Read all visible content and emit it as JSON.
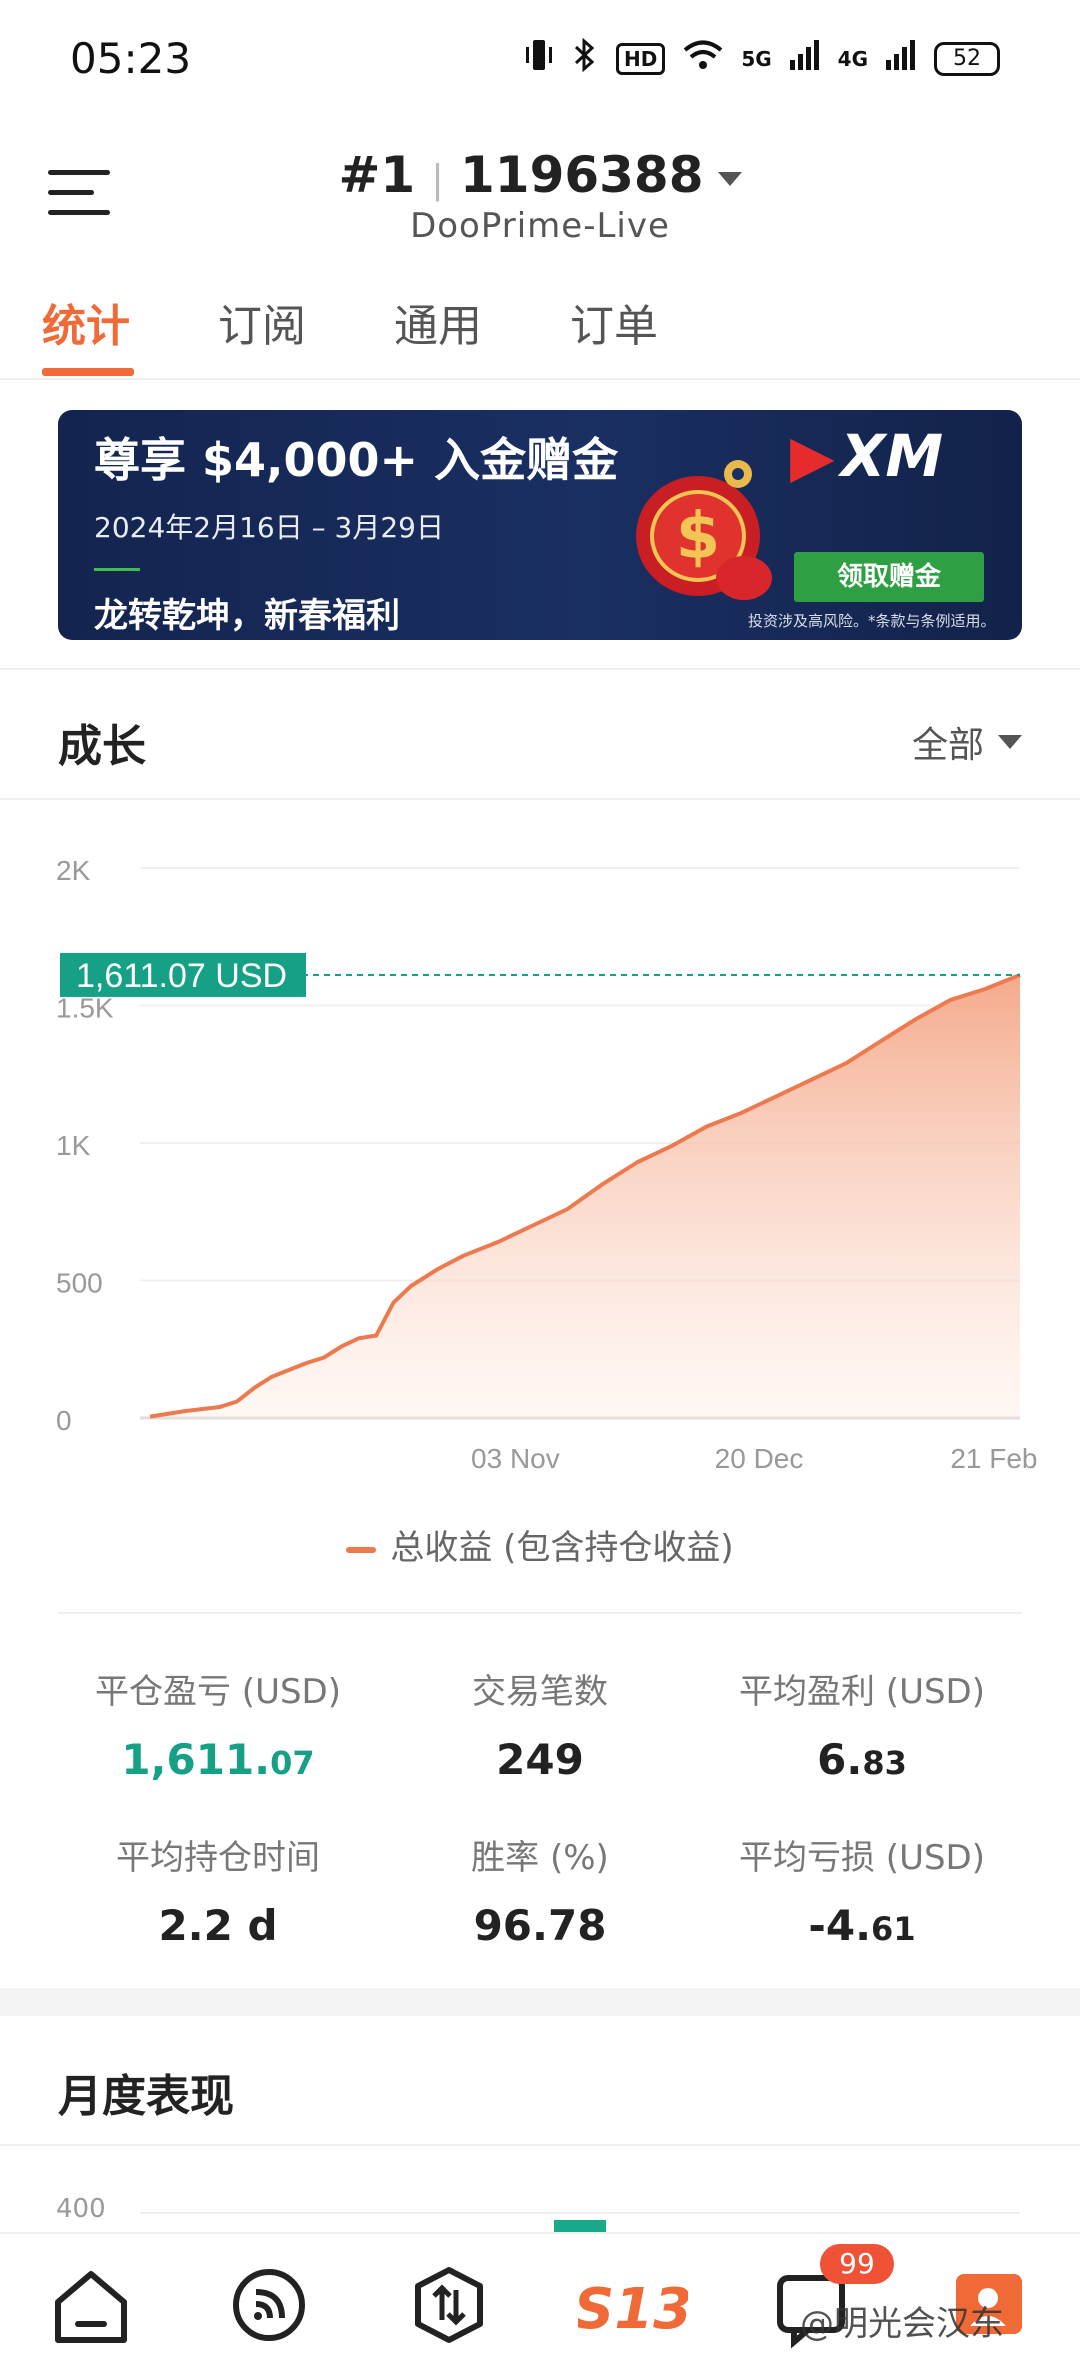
{
  "status_bar": {
    "time": "05:23",
    "network_label": "HD",
    "signal_5g": "5G",
    "signal_4g": "4G",
    "battery": "52"
  },
  "header": {
    "account_rank": "#1",
    "account_id": "1196388",
    "server": "DooPrime-Live"
  },
  "tabs": [
    {
      "label": "统计",
      "active": true
    },
    {
      "label": "订阅",
      "active": false
    },
    {
      "label": "通用",
      "active": false
    },
    {
      "label": "订单",
      "active": false
    }
  ],
  "banner": {
    "headline": "尊享 $4,000+ 入金赠金",
    "date_range": "2024年2月16日 – 3月29日",
    "slogan": "龙转乾坤，新春福利",
    "logo": "XM",
    "cta": "领取赠金",
    "disclaimer": "投资涉及高风险。*条款与条例适用。"
  },
  "growth": {
    "title": "成长",
    "range": "全部",
    "current_value_label": "1,611.07 USD",
    "legend": "总收益 (包含持仓收益)"
  },
  "chart_data": {
    "type": "area",
    "title": "",
    "ylabel": "",
    "xlabel": "",
    "ylim": [
      0,
      2000
    ],
    "y_ticks": [
      "0",
      "500",
      "1K",
      "1.5K",
      "2K"
    ],
    "x_ticks": [
      "03 Nov",
      "20 Dec",
      "21 Feb"
    ],
    "series": [
      {
        "name": "总收益 (包含持仓收益)",
        "color": "#ec7a4e",
        "x_index": [
          0,
          4,
          8,
          10,
          12,
          14,
          16,
          18,
          20,
          22,
          24,
          26,
          28,
          30,
          33,
          36,
          40,
          44,
          48,
          52,
          56,
          60,
          64,
          68,
          72,
          76,
          80,
          84,
          88,
          92,
          96,
          100
        ],
        "values": [
          5,
          25,
          40,
          60,
          110,
          150,
          175,
          200,
          220,
          260,
          290,
          300,
          420,
          480,
          540,
          590,
          640,
          700,
          760,
          850,
          930,
          990,
          1060,
          1110,
          1170,
          1230,
          1290,
          1370,
          1450,
          1520,
          1560,
          1611.07
        ]
      }
    ],
    "last_value": 1611.07,
    "grid": true
  },
  "stats": [
    {
      "label": "平仓盈亏 (USD)",
      "value_main": "1,611.",
      "value_small": "07",
      "highlight": true
    },
    {
      "label": "交易笔数",
      "value_main": "249",
      "value_small": "",
      "highlight": false
    },
    {
      "label": "平均盈利 (USD)",
      "value_main": "6.",
      "value_small": "83",
      "highlight": false
    },
    {
      "label": "平均持仓时间",
      "value_main": "2.2 d",
      "value_small": "",
      "highlight": false
    },
    {
      "label": "胜率 (%)",
      "value_main": "96.78",
      "value_small": "",
      "highlight": false
    },
    {
      "label": "平均亏损 (USD)",
      "value_main": "-4.",
      "value_small": "61",
      "highlight": false
    }
  ],
  "monthly": {
    "title": "月度表现",
    "axis_top": "400"
  },
  "bottom_nav": {
    "items": [
      "home-icon",
      "feed-icon",
      "trade-icon",
      "s13-logo",
      "messages-icon",
      "profile-icon"
    ],
    "logo_text": "S13",
    "badge": "99",
    "watermark": "@明光会汉东"
  },
  "colors": {
    "accent": "#ef6a36",
    "green": "#16a085",
    "chart_line": "#ec7a4e"
  }
}
